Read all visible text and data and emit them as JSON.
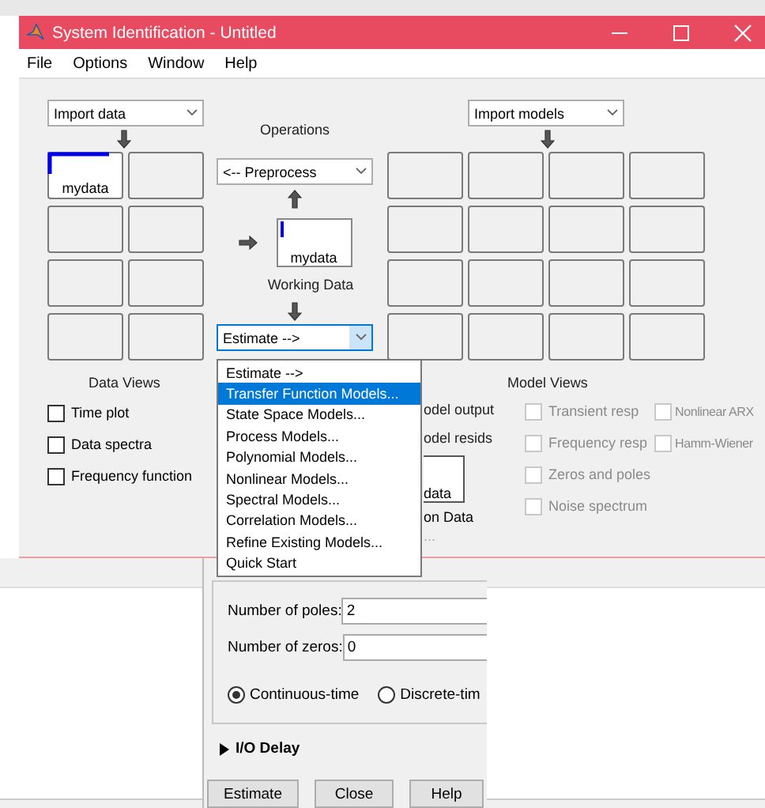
{
  "window": {
    "title": "System Identification - Untitled"
  },
  "menu": [
    {
      "label": "File"
    },
    {
      "label": "Options"
    },
    {
      "label": "Window"
    },
    {
      "label": "Help"
    }
  ],
  "data_panel": {
    "import_select": "Import data",
    "boards": [
      {
        "label": "mydata",
        "selected": true
      }
    ]
  },
  "operations": {
    "label": "Operations",
    "preprocess": "<-- Preprocess",
    "working_data": "mydata",
    "working_caption": "Working Data",
    "estimate": "Estimate -->",
    "estimate_open": true
  },
  "estimate_menu": [
    {
      "label": "Estimate -->",
      "selected": false
    },
    {
      "label": "Transfer Function Models...",
      "selected": true
    },
    {
      "label": "State Space Models...",
      "selected": false
    },
    {
      "label": "Process Models...",
      "selected": false
    },
    {
      "label": "Polynomial Models...",
      "selected": false
    },
    {
      "label": "Nonlinear Models...",
      "selected": false
    },
    {
      "label": "Spectral Models...",
      "selected": false
    },
    {
      "label": "Correlation Models...",
      "selected": false
    },
    {
      "label": "Refine Existing Models...",
      "selected": false
    },
    {
      "label": "Quick Start",
      "selected": false
    }
  ],
  "data_views": {
    "title": "Data Views",
    "options": [
      {
        "label": "Time plot",
        "checked": false
      },
      {
        "label": "Data spectra",
        "checked": false
      },
      {
        "label": "Frequency function",
        "checked": false
      }
    ]
  },
  "models_panel": {
    "import_select": "Import models"
  },
  "partly_hidden": [
    {
      "kind": "text",
      "label": "odel output"
    },
    {
      "kind": "text",
      "label": "odel resids"
    },
    {
      "kind": "board",
      "label": "data"
    },
    {
      "kind": "caption",
      "label": "on Data"
    },
    {
      "kind": "hint",
      "label": "..."
    }
  ],
  "model_views": {
    "title": "Model Views",
    "groups": [
      {
        "options": [
          {
            "label": "Transient resp",
            "checked": false,
            "disabled": true
          },
          {
            "label": "Frequency resp",
            "checked": false,
            "disabled": true
          },
          {
            "label": "Zeros and poles",
            "checked": false,
            "disabled": true
          },
          {
            "label": "Noise spectrum",
            "checked": false,
            "disabled": true
          }
        ]
      },
      {
        "options": [
          {
            "label": "Nonlinear ARX",
            "checked": false,
            "disabled": true
          },
          {
            "label": "Hamm-Wiener",
            "checked": false,
            "disabled": true
          }
        ]
      }
    ]
  },
  "dialog": {
    "fields": [
      {
        "label": "Number of poles:",
        "value": "2"
      },
      {
        "label": "Number of zeros:",
        "value": "0"
      }
    ],
    "time_domain": [
      {
        "label": "Continuous-time",
        "selected": true
      },
      {
        "label": "Discrete-tim",
        "selected": false
      }
    ],
    "io_delay": {
      "label": "I/O Delay",
      "expanded": false
    },
    "buttons": [
      {
        "label": "Estimate"
      },
      {
        "label": "Close"
      },
      {
        "label": "Help"
      }
    ]
  }
}
